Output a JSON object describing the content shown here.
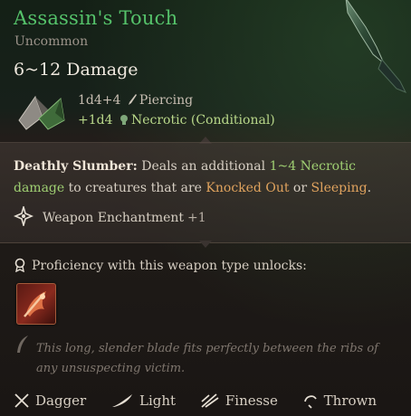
{
  "item": {
    "name": "Assassin's Touch",
    "rarity": "Uncommon",
    "damage_total": "6~12 Damage",
    "damage_lines": [
      {
        "dice": "1d4+4",
        "type": "Piercing"
      },
      {
        "dice": "+1d4",
        "type": "Necrotic (Conditional)"
      }
    ]
  },
  "passive": {
    "name": "Deathly Slumber:",
    "text_1": "Deals an additional",
    "dmg_range": "1~4 Necrotic",
    "dmg_word": "damage",
    "text_2": "to creatures that are",
    "cond_1": "Knocked Out",
    "or": "or",
    "cond_2": "Sleeping",
    "period": "."
  },
  "enchantment": {
    "label": "Weapon Enchantment",
    "value": "+1"
  },
  "proficiency": {
    "label": "Proficiency with this weapon type unlocks:"
  },
  "lore": "This long, slender blade fits perfectly between the ribs of any unsuspecting victim.",
  "properties": [
    {
      "label": "Dagger",
      "icon": "crossed-daggers-icon"
    },
    {
      "label": "Light",
      "icon": "feather-icon"
    },
    {
      "label": "Finesse",
      "icon": "slash-icon"
    },
    {
      "label": "Thrown",
      "icon": "thrown-icon"
    }
  ],
  "colors": {
    "title": "#55c26a",
    "necrotic": "#9fcf72",
    "condition": "#e0a35e"
  }
}
